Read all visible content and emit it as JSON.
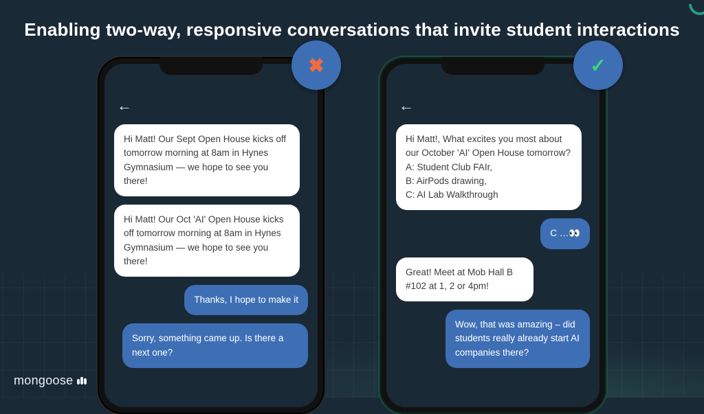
{
  "headline": "Enabling two-way, responsive conversations that invite student interactions",
  "logo": {
    "text": "mongoose"
  },
  "phones": {
    "left": {
      "badge": "✖",
      "backArrow": "←",
      "messages": [
        {
          "type": "incoming",
          "text": "Hi Matt! Our Sept Open House kicks off tomorrow morning at 8am in Hynes Gymnasium — we hope to see you there!"
        },
        {
          "type": "incoming",
          "text": "Hi Matt! Our Oct 'AI' Open House kicks off tomorrow morning at 8am in Hynes Gymnasium — we hope to see you there!"
        },
        {
          "type": "outgoing",
          "text": "Thanks, I hope to make it"
        },
        {
          "type": "outgoing",
          "text": "Sorry, something came up. Is there a next one?"
        }
      ]
    },
    "right": {
      "badge": "✓",
      "backArrow": "←",
      "messages": [
        {
          "type": "incoming",
          "text": "Hi Matt!, What excites you most about our October 'AI' Open House tomorrow?\n A: Student Club FAIr,\n B: AirPods drawing,\n C: AI Lab Walkthrough"
        },
        {
          "type": "outgoing",
          "text": "C …👀"
        },
        {
          "type": "incoming",
          "text": "Great! Meet at Mob Hall B #102 at 1, 2 or 4pm!"
        },
        {
          "type": "outgoing",
          "text": "Wow, that was amazing – did students really already start AI companies there?"
        }
      ]
    }
  }
}
